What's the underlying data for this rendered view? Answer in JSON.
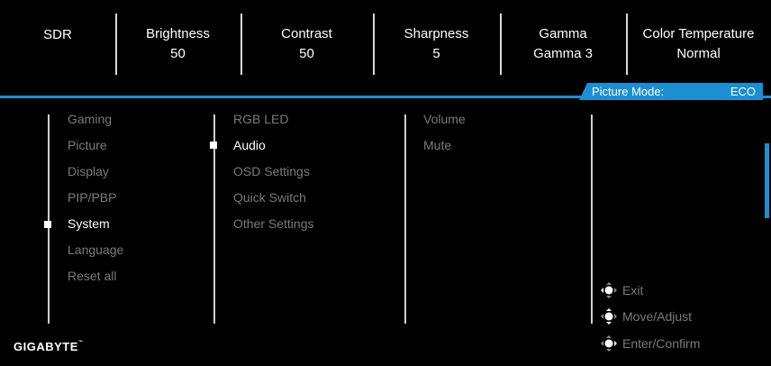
{
  "topbar": [
    {
      "label": "SDR",
      "value": ""
    },
    {
      "label": "Brightness",
      "value": "50"
    },
    {
      "label": "Contrast",
      "value": "50"
    },
    {
      "label": "Sharpness",
      "value": "5"
    },
    {
      "label": "Gamma",
      "value": "Gamma 3"
    },
    {
      "label": "Color Temperature",
      "value": "Normal"
    }
  ],
  "picture_mode": {
    "label": "Picture Mode:",
    "value": "ECO"
  },
  "menu_level1": [
    "Gaming",
    "Picture",
    "Display",
    "PIP/PBP",
    "System",
    "Language",
    "Reset all"
  ],
  "menu_level1_selected": "System",
  "menu_level2": [
    "RGB LED",
    "Audio",
    "OSD Settings",
    "Quick Switch",
    "Other Settings"
  ],
  "menu_level2_selected": "Audio",
  "menu_level3": [
    "Volume",
    "Mute"
  ],
  "legend": {
    "exit": "Exit",
    "move": "Move/Adjust",
    "enter": "Enter/Confirm"
  },
  "brand": {
    "name": "GIGABYTE",
    "mark": "™"
  },
  "colors": {
    "accent": "#1b8fd2",
    "inactive_text": "#7a7a7a",
    "active_text": "#ffffff",
    "background": "#000000"
  }
}
